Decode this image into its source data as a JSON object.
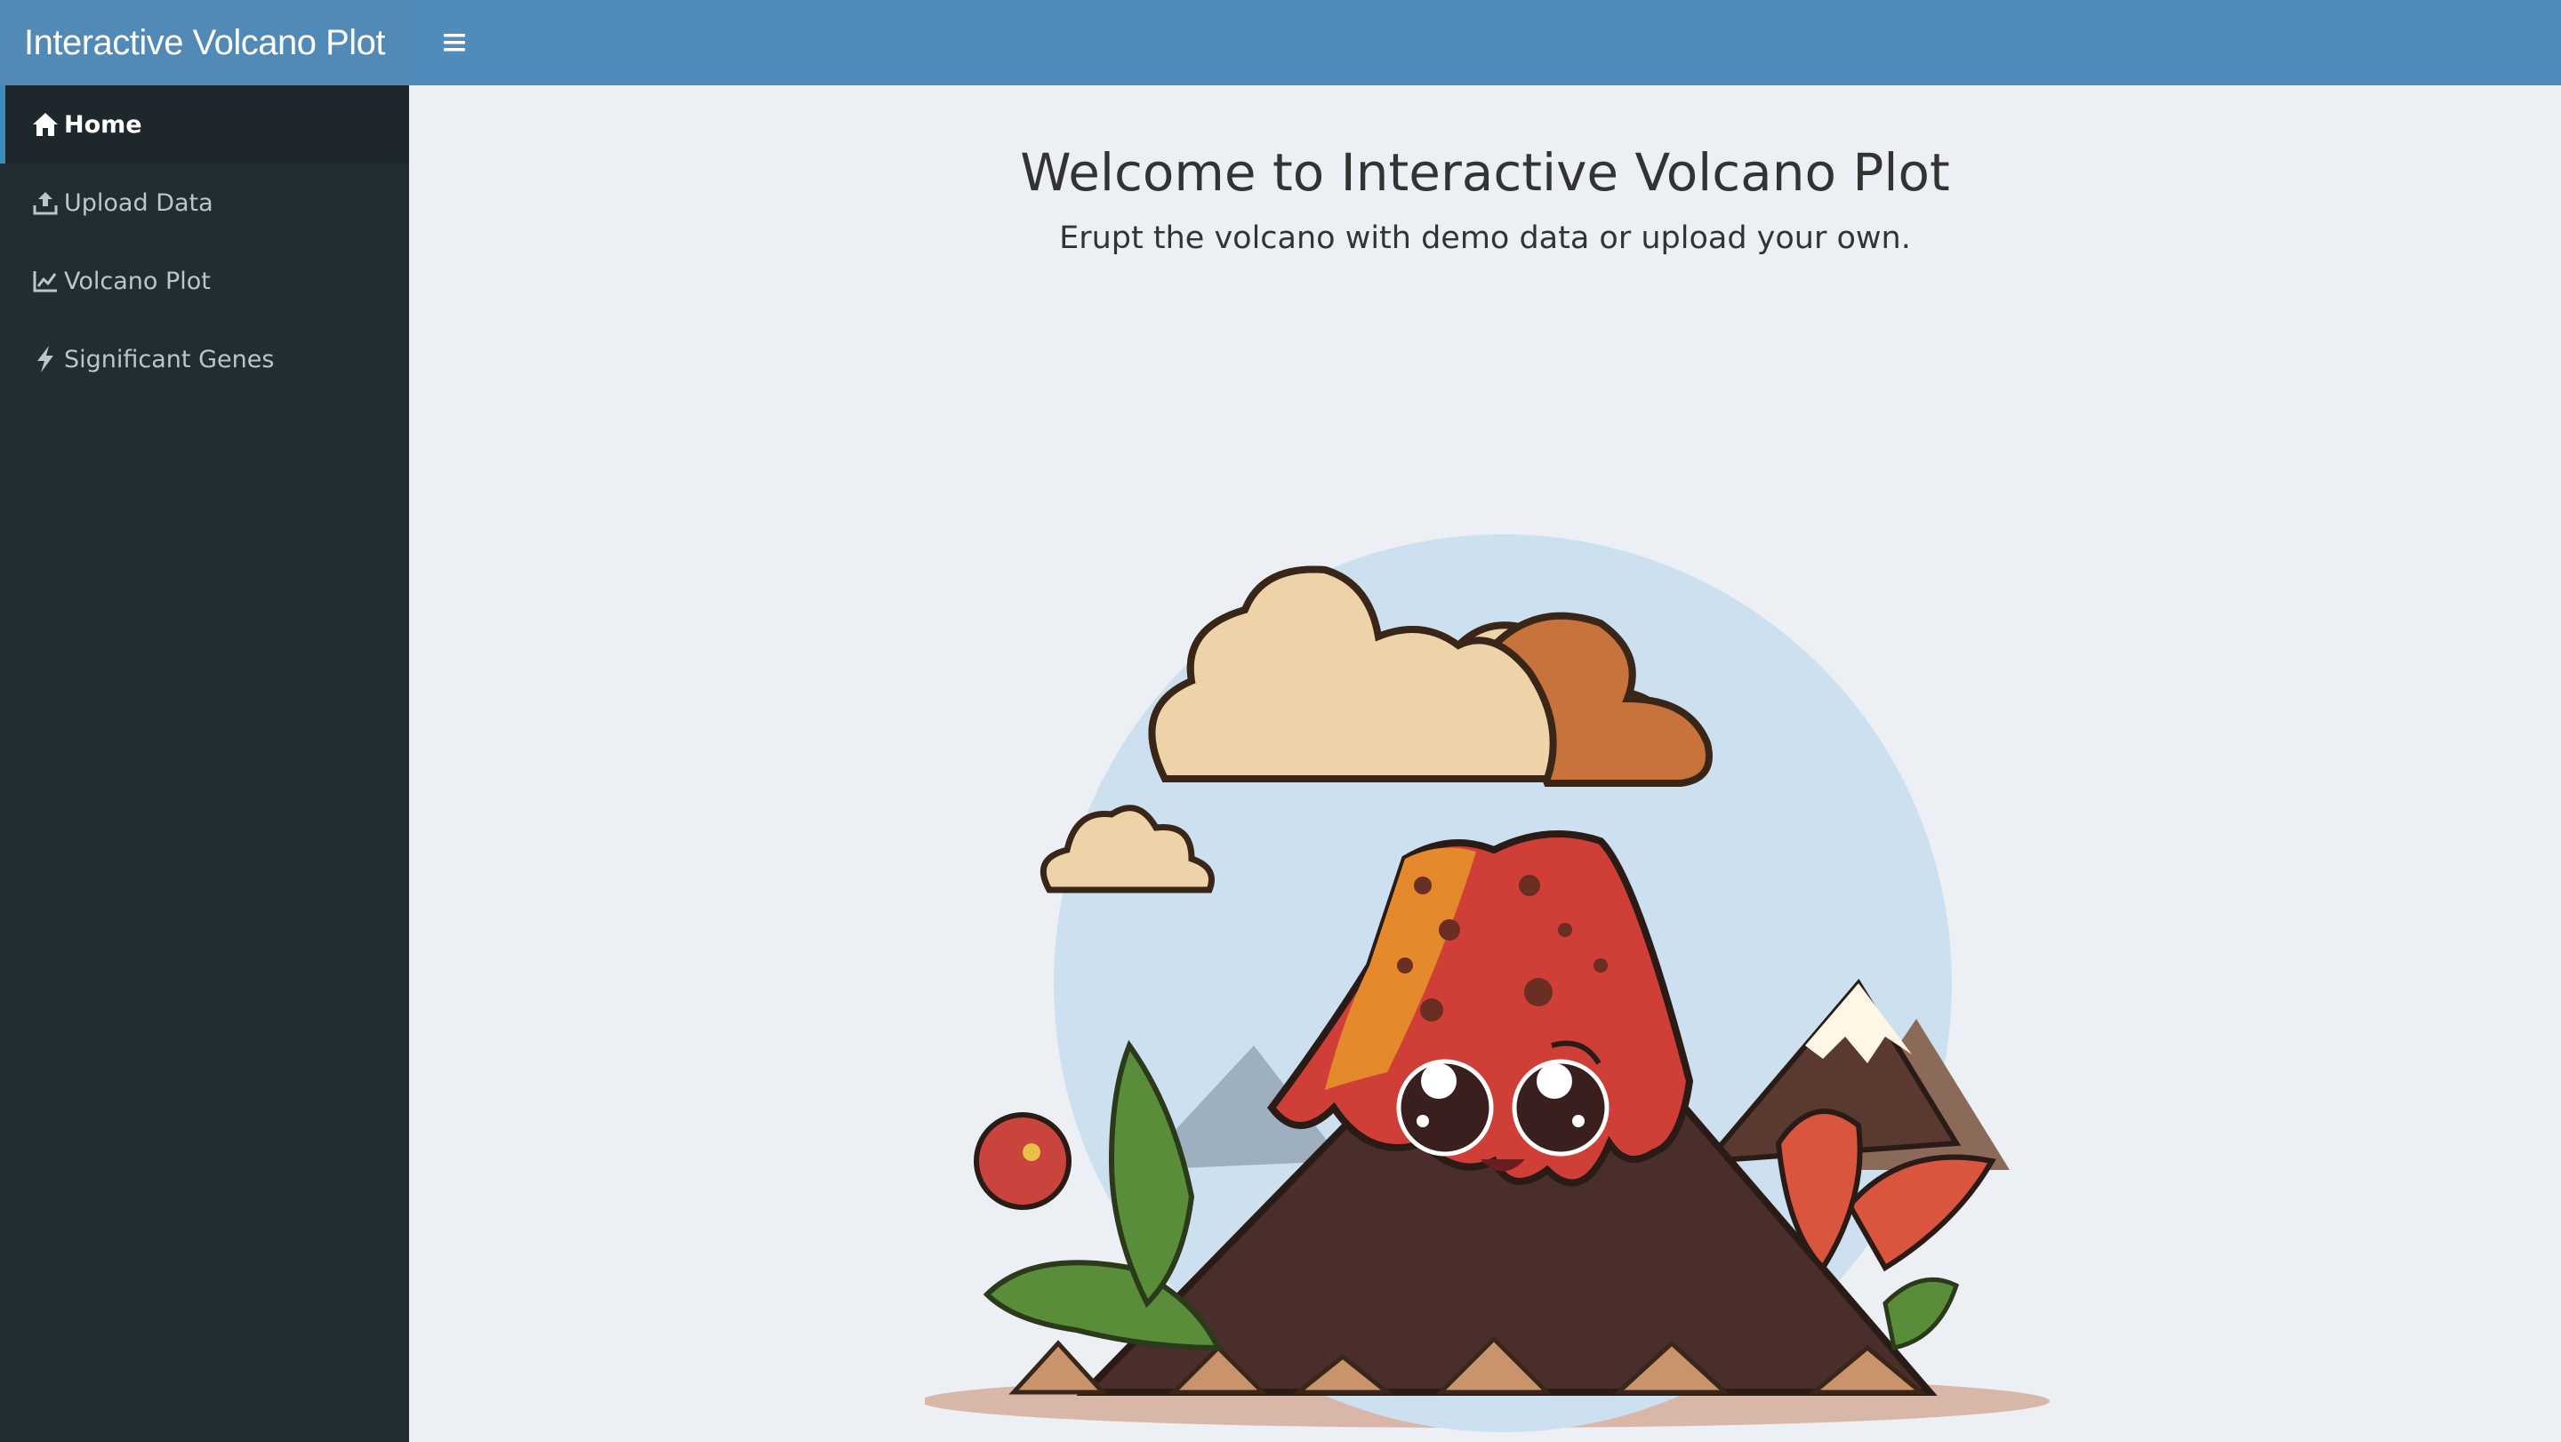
{
  "app": {
    "title": "Interactive Volcano Plot"
  },
  "header": {
    "toggle_icon": "hamburger-menu-icon"
  },
  "sidebar": {
    "items": [
      {
        "label": "Home",
        "icon": "home-icon",
        "active": true
      },
      {
        "label": "Upload Data",
        "icon": "upload-icon",
        "active": false
      },
      {
        "label": "Volcano Plot",
        "icon": "line-chart-icon",
        "active": false
      },
      {
        "label": "Significant Genes",
        "icon": "lightning-bolt-icon",
        "active": false
      }
    ]
  },
  "main": {
    "title": "Welcome to Interactive Volcano Plot",
    "subtitle": "Erupt the volcano with demo data or upload your own.",
    "illustration": "cartoon-volcano-illustration"
  },
  "colors": {
    "header": "#5189b7",
    "sidebar": "#222d32",
    "sidebar_active": "#1e282c",
    "accent": "#3c8dbc",
    "content_bg": "#ecf0f5"
  }
}
